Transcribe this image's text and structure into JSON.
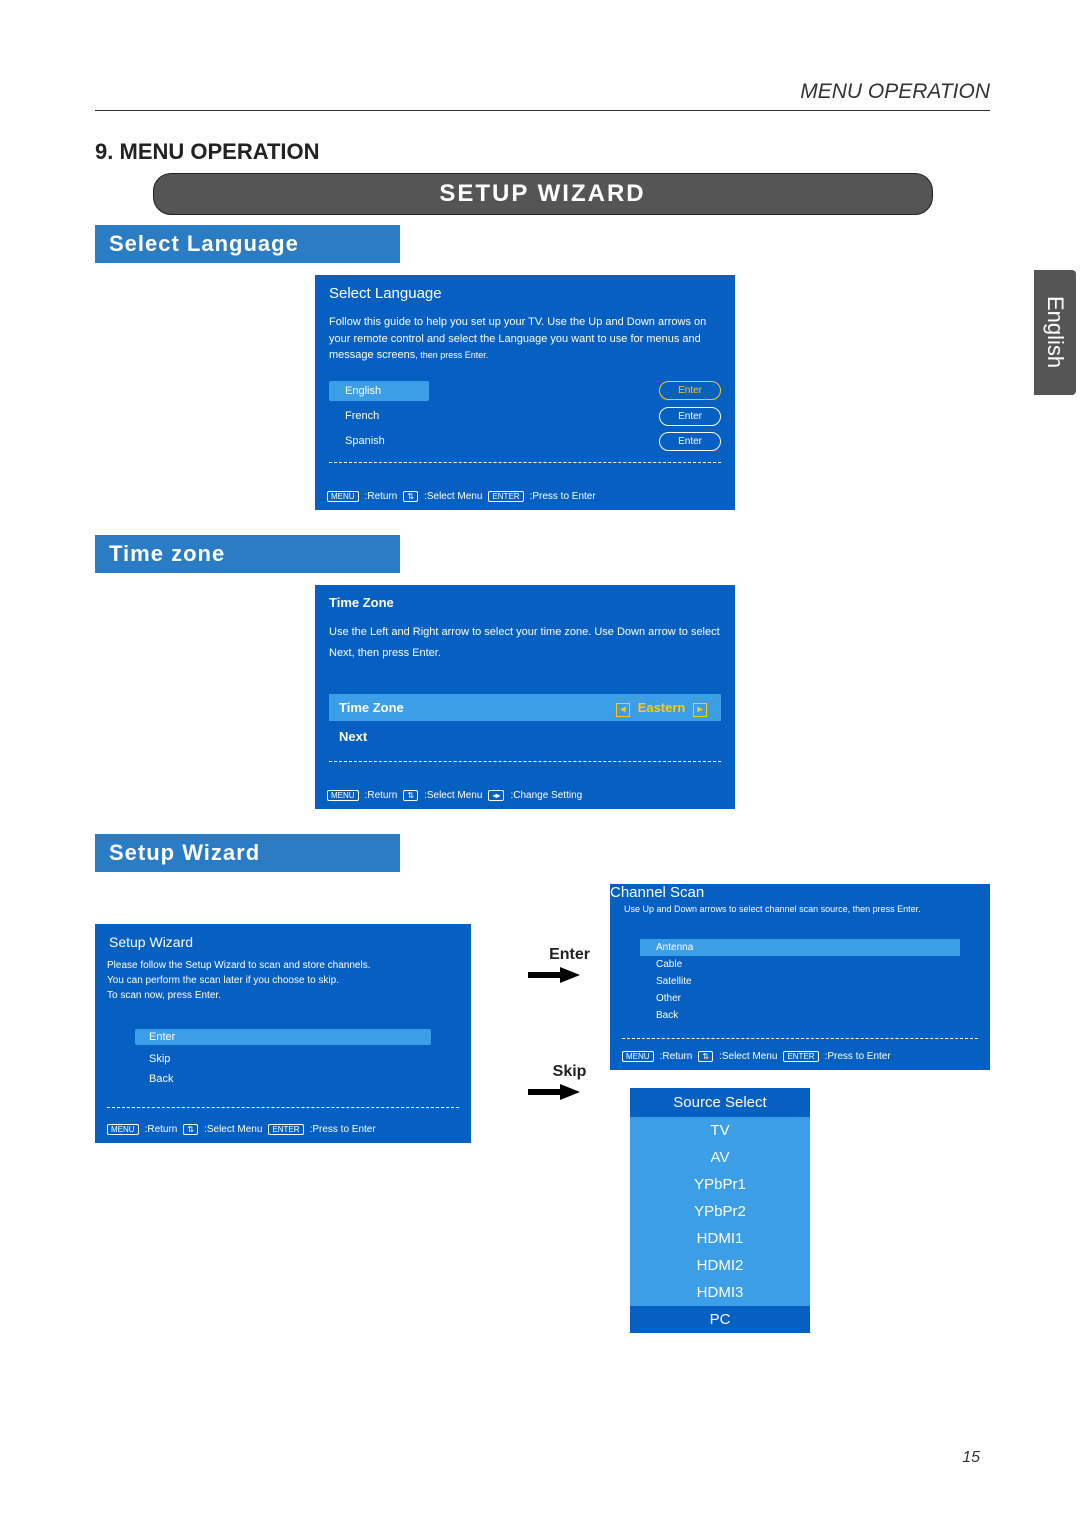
{
  "header": {
    "topRight": "MENU OPERATION",
    "sectionNum": "9",
    "sectionTitle": "MENU OPERATION"
  },
  "sideTab": "English",
  "pillTitle": "SETUP WIZARD",
  "selectLanguage": {
    "heading": "Select Language",
    "panelTitle": "Select Language",
    "body1": "Follow this guide to help you set up your TV. Use the Up and Down arrows on your remote control and select the Language you want to use for menus and message screens",
    "body2": ", then press Enter.",
    "options": [
      "English",
      "French",
      "Spanish"
    ],
    "enterLabel": "Enter",
    "footer": {
      "menu": "MENU",
      "return": ":Return",
      "select": ":Select Menu",
      "enterKey": "ENTER",
      "press": ":Press to Enter"
    }
  },
  "timeZone": {
    "heading": "Time zone",
    "panelTitle": "Time Zone",
    "body": "Use the Left and Right arrow to select your time zone. Use Down arrow to select Next, then press Enter.",
    "rowLabel": "Time Zone",
    "rowValue": "Eastern",
    "next": "Next",
    "footer": {
      "menu": "MENU",
      "return": ":Return",
      "select": ":Select Menu",
      "change": ":Change Setting"
    }
  },
  "setupWizard": {
    "heading": "Setup Wizard",
    "panelTitle": "Setup Wizard",
    "body1": "Please follow the Setup Wizard to scan and store channels.",
    "body2": "You can perform the scan later if you choose to skip.",
    "body3": "To scan now, press Enter.",
    "options": [
      "Enter",
      "Skip",
      "Back"
    ],
    "footer": {
      "menu": "MENU",
      "return": ":Return",
      "select": ":Select Menu",
      "enterKey": "ENTER",
      "press": ":Press to Enter"
    },
    "arrowEnter": "Enter",
    "arrowSkip": "Skip"
  },
  "channelScan": {
    "panelTitle": "Channel Scan",
    "body": "Use Up and Down arrows to select channel scan source, then press Enter.",
    "options": [
      "Antenna",
      "Cable",
      "Satellite",
      "Other",
      "Back"
    ],
    "footer": {
      "menu": "MENU",
      "return": ":Return",
      "select": ":Select Menu",
      "enterKey": "ENTER",
      "press": ":Press to Enter"
    }
  },
  "sourceSelect": {
    "title": "Source Select",
    "options": [
      "TV",
      "AV",
      "YPbPr1",
      "YPbPr2",
      "HDMI1",
      "HDMI2",
      "HDMI3",
      "PC"
    ]
  },
  "pageNum": "15"
}
